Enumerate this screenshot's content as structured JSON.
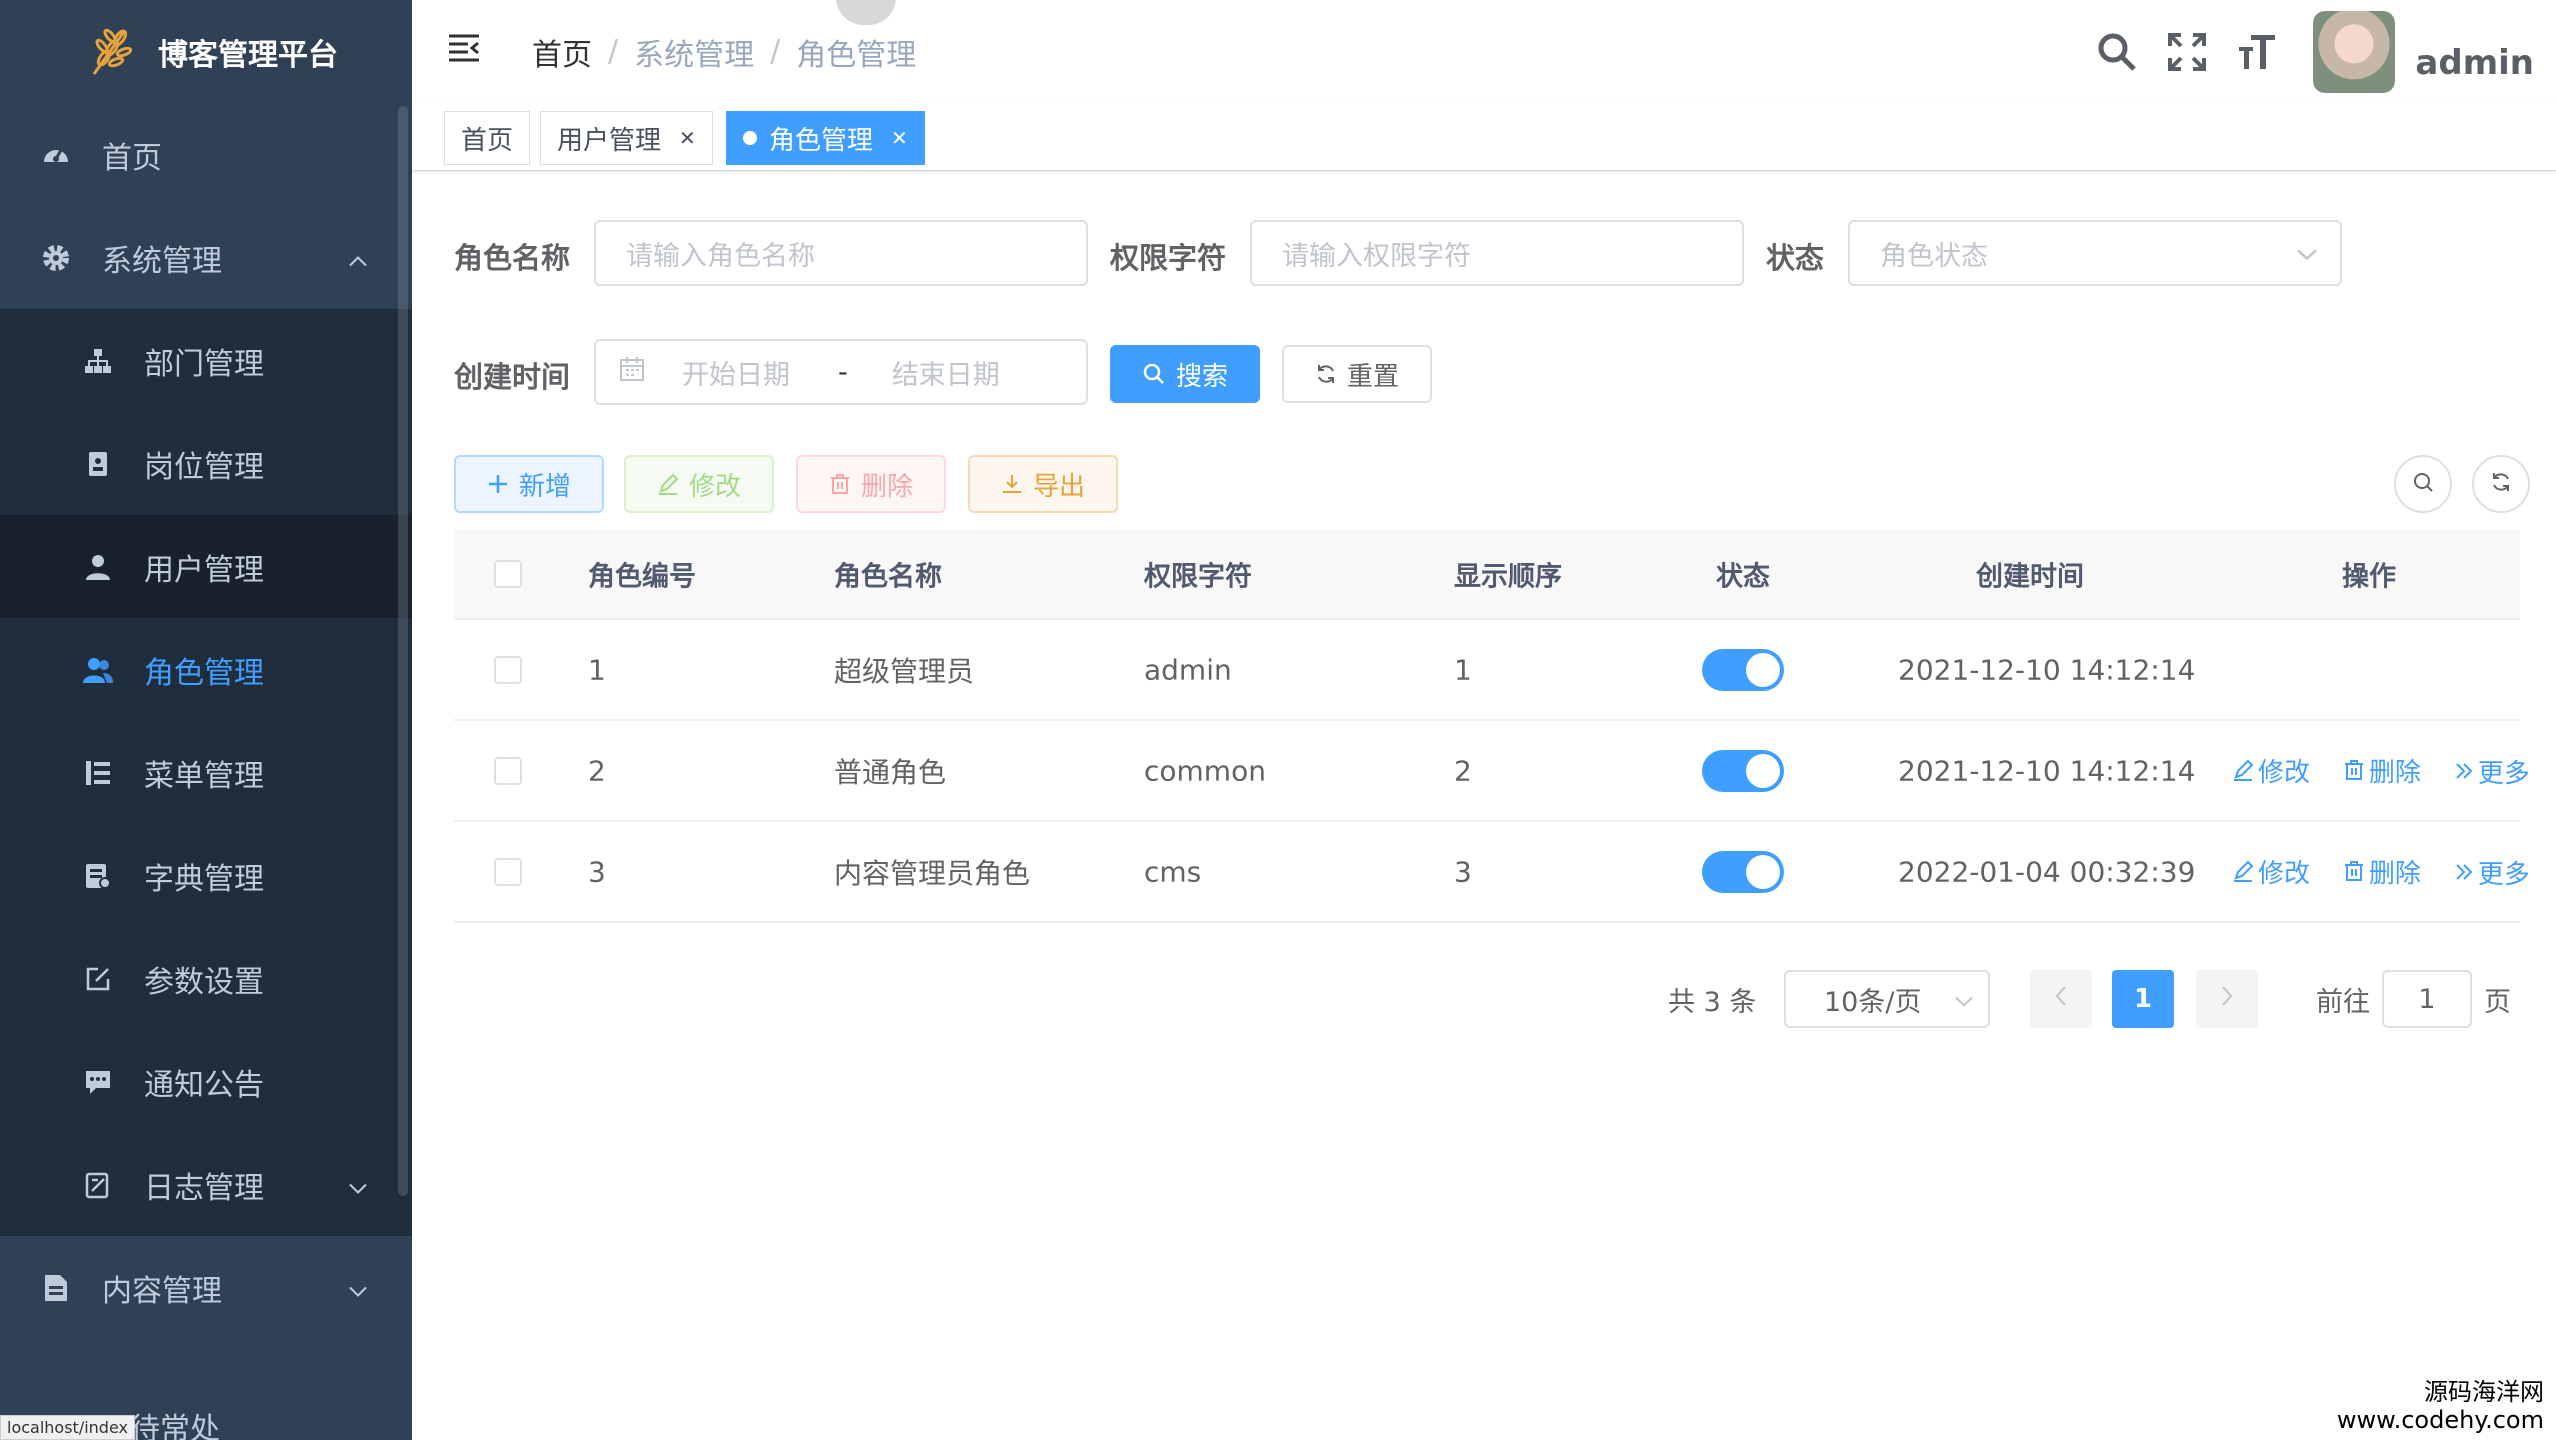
{
  "app": {
    "title": "博客管理平台"
  },
  "sidebar": {
    "items": [
      {
        "label": "首页",
        "icon": "dashboard-icon"
      },
      {
        "label": "系统管理",
        "icon": "gear-icon",
        "expanded": true
      },
      {
        "label": "部门管理",
        "icon": "tree-icon"
      },
      {
        "label": "岗位管理",
        "icon": "post-icon"
      },
      {
        "label": "用户管理",
        "icon": "user-icon"
      },
      {
        "label": "角色管理",
        "icon": "peoples-icon",
        "active": true
      },
      {
        "label": "菜单管理",
        "icon": "tree-table-icon"
      },
      {
        "label": "字典管理",
        "icon": "dict-icon"
      },
      {
        "label": "参数设置",
        "icon": "edit-icon"
      },
      {
        "label": "通知公告",
        "icon": "message-icon"
      },
      {
        "label": "日志管理",
        "icon": "log-icon"
      },
      {
        "label": "内容管理",
        "icon": "document-icon"
      }
    ],
    "partial_item": "待常处",
    "status_url": "localhost/index"
  },
  "header": {
    "breadcrumb": [
      "首页",
      "系统管理",
      "角色管理"
    ],
    "username": "admin"
  },
  "tags": [
    {
      "label": "首页"
    },
    {
      "label": "用户管理"
    },
    {
      "label": "角色管理",
      "active": true
    }
  ],
  "search": {
    "role_name_label": "角色名称",
    "role_name_placeholder": "请输入角色名称",
    "role_key_label": "权限字符",
    "role_key_placeholder": "请输入权限字符",
    "status_label": "状态",
    "status_placeholder": "角色状态",
    "created_label": "创建时间",
    "start_placeholder": "开始日期",
    "range_sep": "-",
    "end_placeholder": "结束日期",
    "search_button": "搜索",
    "reset_button": "重置"
  },
  "toolbar": {
    "add": "新增",
    "edit": "修改",
    "delete": "删除",
    "export": "导出"
  },
  "table": {
    "columns": [
      "角色编号",
      "角色名称",
      "权限字符",
      "显示顺序",
      "状态",
      "创建时间",
      "操作"
    ],
    "rows": [
      {
        "id": "1",
        "name": "超级管理员",
        "key": "admin",
        "sort": "1",
        "enabled": true,
        "created": "2021-12-10 14:12:14",
        "ops": false
      },
      {
        "id": "2",
        "name": "普通角色",
        "key": "common",
        "sort": "2",
        "enabled": true,
        "created": "2021-12-10 14:12:14",
        "ops": true
      },
      {
        "id": "3",
        "name": "内容管理员角色",
        "key": "cms",
        "sort": "3",
        "enabled": true,
        "created": "2022-01-04 00:32:39",
        "ops": true
      }
    ],
    "op_edit": "修改",
    "op_delete": "删除",
    "op_more": "更多"
  },
  "pagination": {
    "total": "共 3 条",
    "page_size": "10条/页",
    "current": "1",
    "goto_label": "前往",
    "goto_value": "1",
    "page_suffix": "页"
  },
  "watermark": {
    "line1": "源码海洋网",
    "line2": "www.codehy.com"
  },
  "colors": {
    "sidebar": "#304156",
    "submenu": "#1f2d3d",
    "primary": "#409eff"
  }
}
